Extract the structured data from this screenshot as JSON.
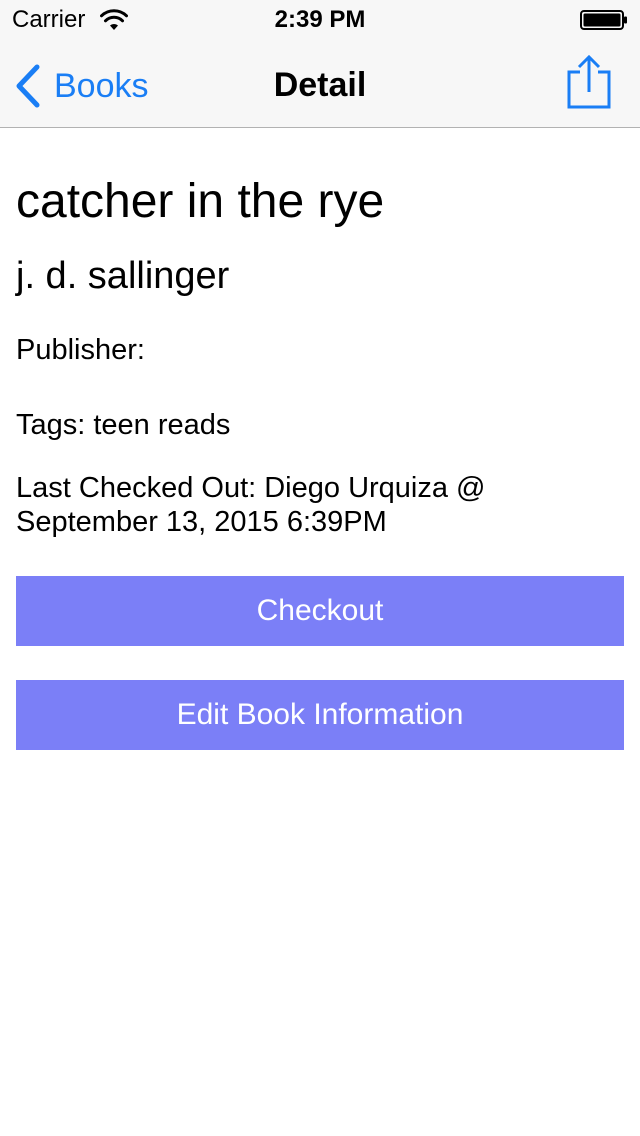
{
  "status_bar": {
    "carrier": "Carrier",
    "time": "2:39 PM",
    "icons": [
      "wifi-icon",
      "battery-icon"
    ]
  },
  "nav": {
    "back_label": "Books",
    "title": "Detail",
    "right_icon": "share-icon",
    "tint_color": "#1a7ef5"
  },
  "book": {
    "title": "catcher in the rye",
    "author": "j. d. sallinger",
    "publisher_line": "Publisher:",
    "tags_line": "Tags: teen reads",
    "last_checked_out_line1": "Last Checked Out: Diego Urquiza @",
    "last_checked_out_line2": "September 13, 2015 6:39PM"
  },
  "actions": {
    "checkout_label": "Checkout",
    "edit_label": "Edit Book Information",
    "button_color": "#7b7ff7"
  }
}
